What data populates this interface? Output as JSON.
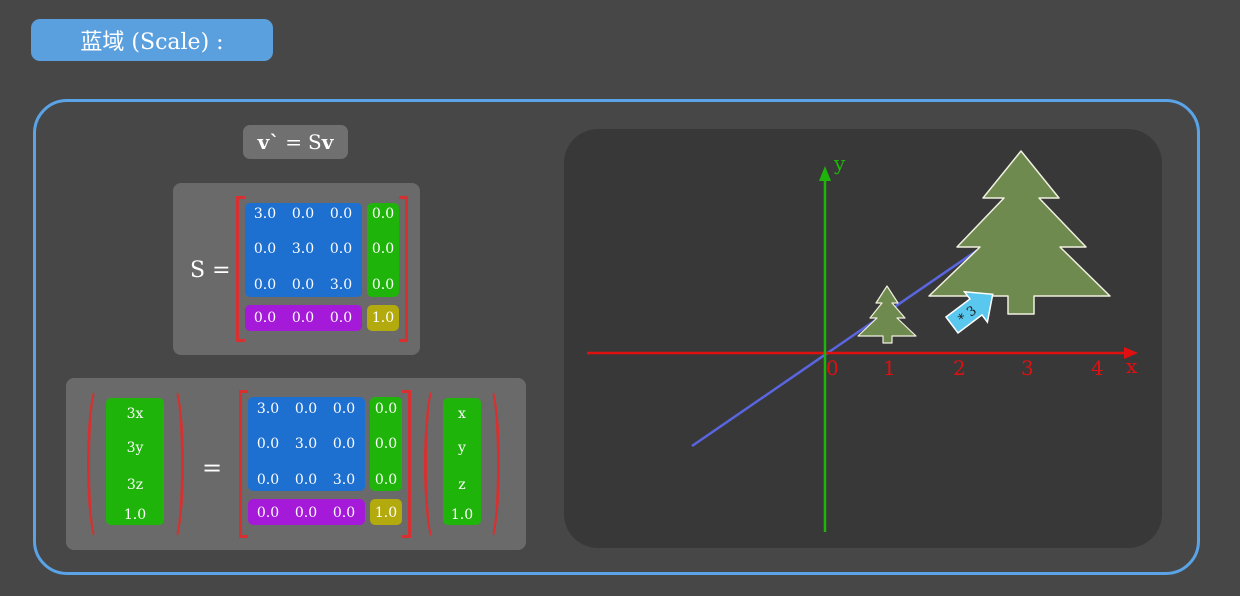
{
  "header": {
    "title": "蓝域 (Scale) :"
  },
  "formula": {
    "lhs": "v`",
    "eq": "=",
    "rhs_s": "S",
    "rhs_v": "v"
  },
  "matrix_s": {
    "label": "S =",
    "rows": [
      [
        "3.0",
        "0.0",
        "0.0",
        "0.0"
      ],
      [
        "0.0",
        "3.0",
        "0.0",
        "0.0"
      ],
      [
        "0.0",
        "0.0",
        "3.0",
        "0.0"
      ],
      [
        "0.0",
        "0.0",
        "0.0",
        "1.0"
      ]
    ]
  },
  "equation": {
    "result": [
      "3x",
      "3y",
      "3z",
      "1.0"
    ],
    "equals": "=",
    "rows": [
      [
        "3.0",
        "0.0",
        "0.0",
        "0.0"
      ],
      [
        "0.0",
        "3.0",
        "0.0",
        "0.0"
      ],
      [
        "0.0",
        "0.0",
        "3.0",
        "0.0"
      ],
      [
        "0.0",
        "0.0",
        "0.0",
        "1.0"
      ]
    ],
    "vector": [
      "x",
      "y",
      "z",
      "1.0"
    ]
  },
  "plot": {
    "x_axis_label": "x",
    "y_axis_label": "y",
    "x_ticks": [
      "0",
      "1",
      "2",
      "3",
      "4"
    ],
    "arrow_label": "* 3",
    "colors": {
      "x_axis": "#e01010",
      "y_axis": "#1fb40a",
      "diagonal": "#5a66e0",
      "tree_fill": "#6f8a4f",
      "tree_stroke": "#f0f0e0",
      "arrow": "#5ac8ee"
    }
  },
  "colors": {
    "background": "#474747",
    "title_pill": "#5a9fde",
    "frame": "#5aa3e6",
    "bracket": "#d83030",
    "block_blue": "#1d6fd0",
    "block_green": "#1fb40a",
    "block_purple": "#a51ad8",
    "block_yellow": "#b3aa0d"
  }
}
